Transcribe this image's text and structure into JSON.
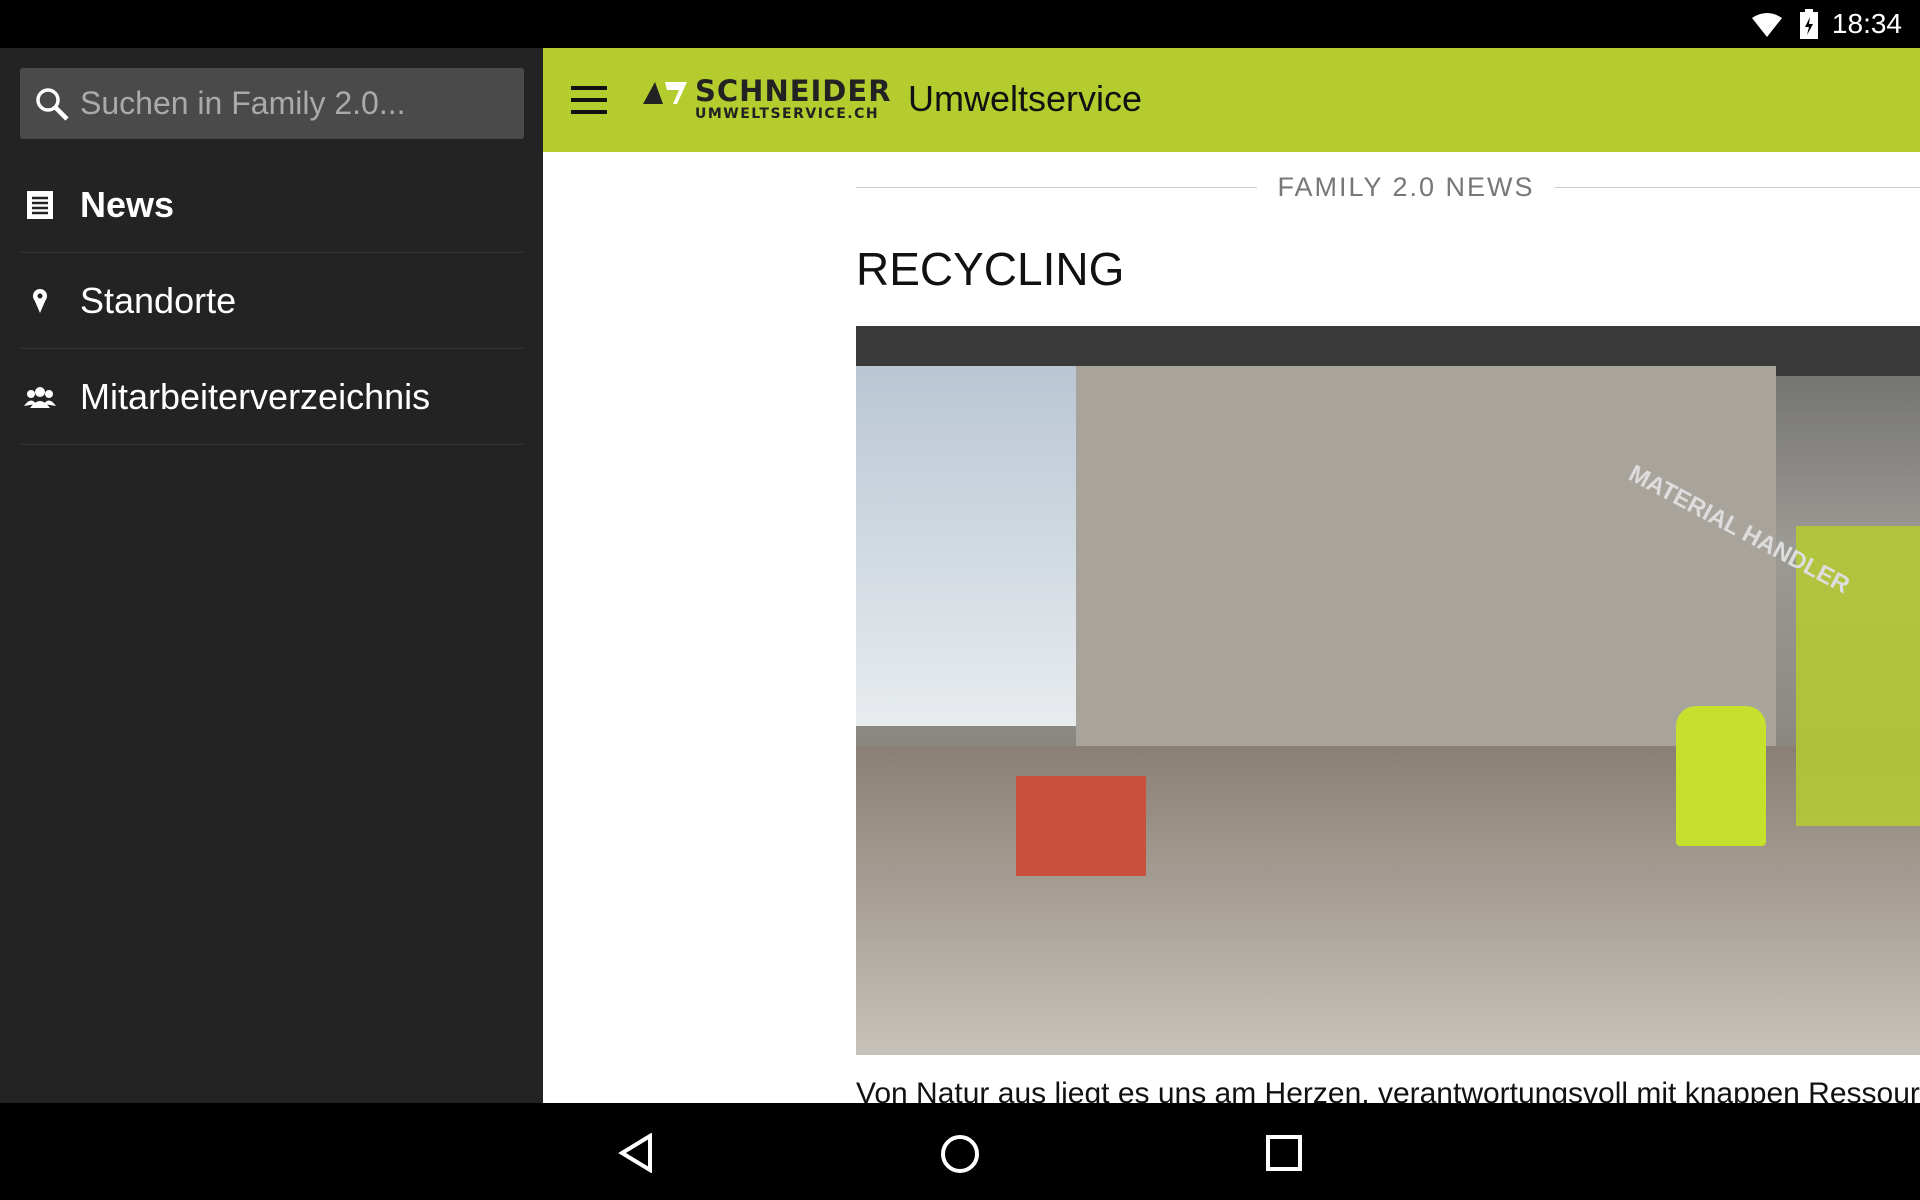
{
  "status_bar": {
    "time": "18:34",
    "icons": [
      "wifi-icon",
      "battery-icon"
    ]
  },
  "drawer": {
    "search_placeholder": "Suchen in Family 2.0...",
    "items": [
      {
        "label": "News",
        "icon": "news-icon",
        "active": true
      },
      {
        "label": "Standorte",
        "icon": "location-pin-icon"
      },
      {
        "label": "Mitarbeiterverzeichnis",
        "icon": "people-icon"
      }
    ]
  },
  "header": {
    "logo_brand": "SCHNEIDER",
    "logo_sub": "UMWELTSERVICE.CH",
    "title": "Umweltservice",
    "color": "#b5cc2e"
  },
  "main": {
    "section_label": "FAMILY 2.0 NEWS",
    "article_title": "RECYCLING",
    "image_text": "MATERIAL HANDLER",
    "body_text": "Von Natur aus liegt es uns am Herzen, verantwortungsvoll mit knappen Ressourcen"
  },
  "navbar": {
    "buttons": [
      "back",
      "home",
      "recents"
    ]
  }
}
